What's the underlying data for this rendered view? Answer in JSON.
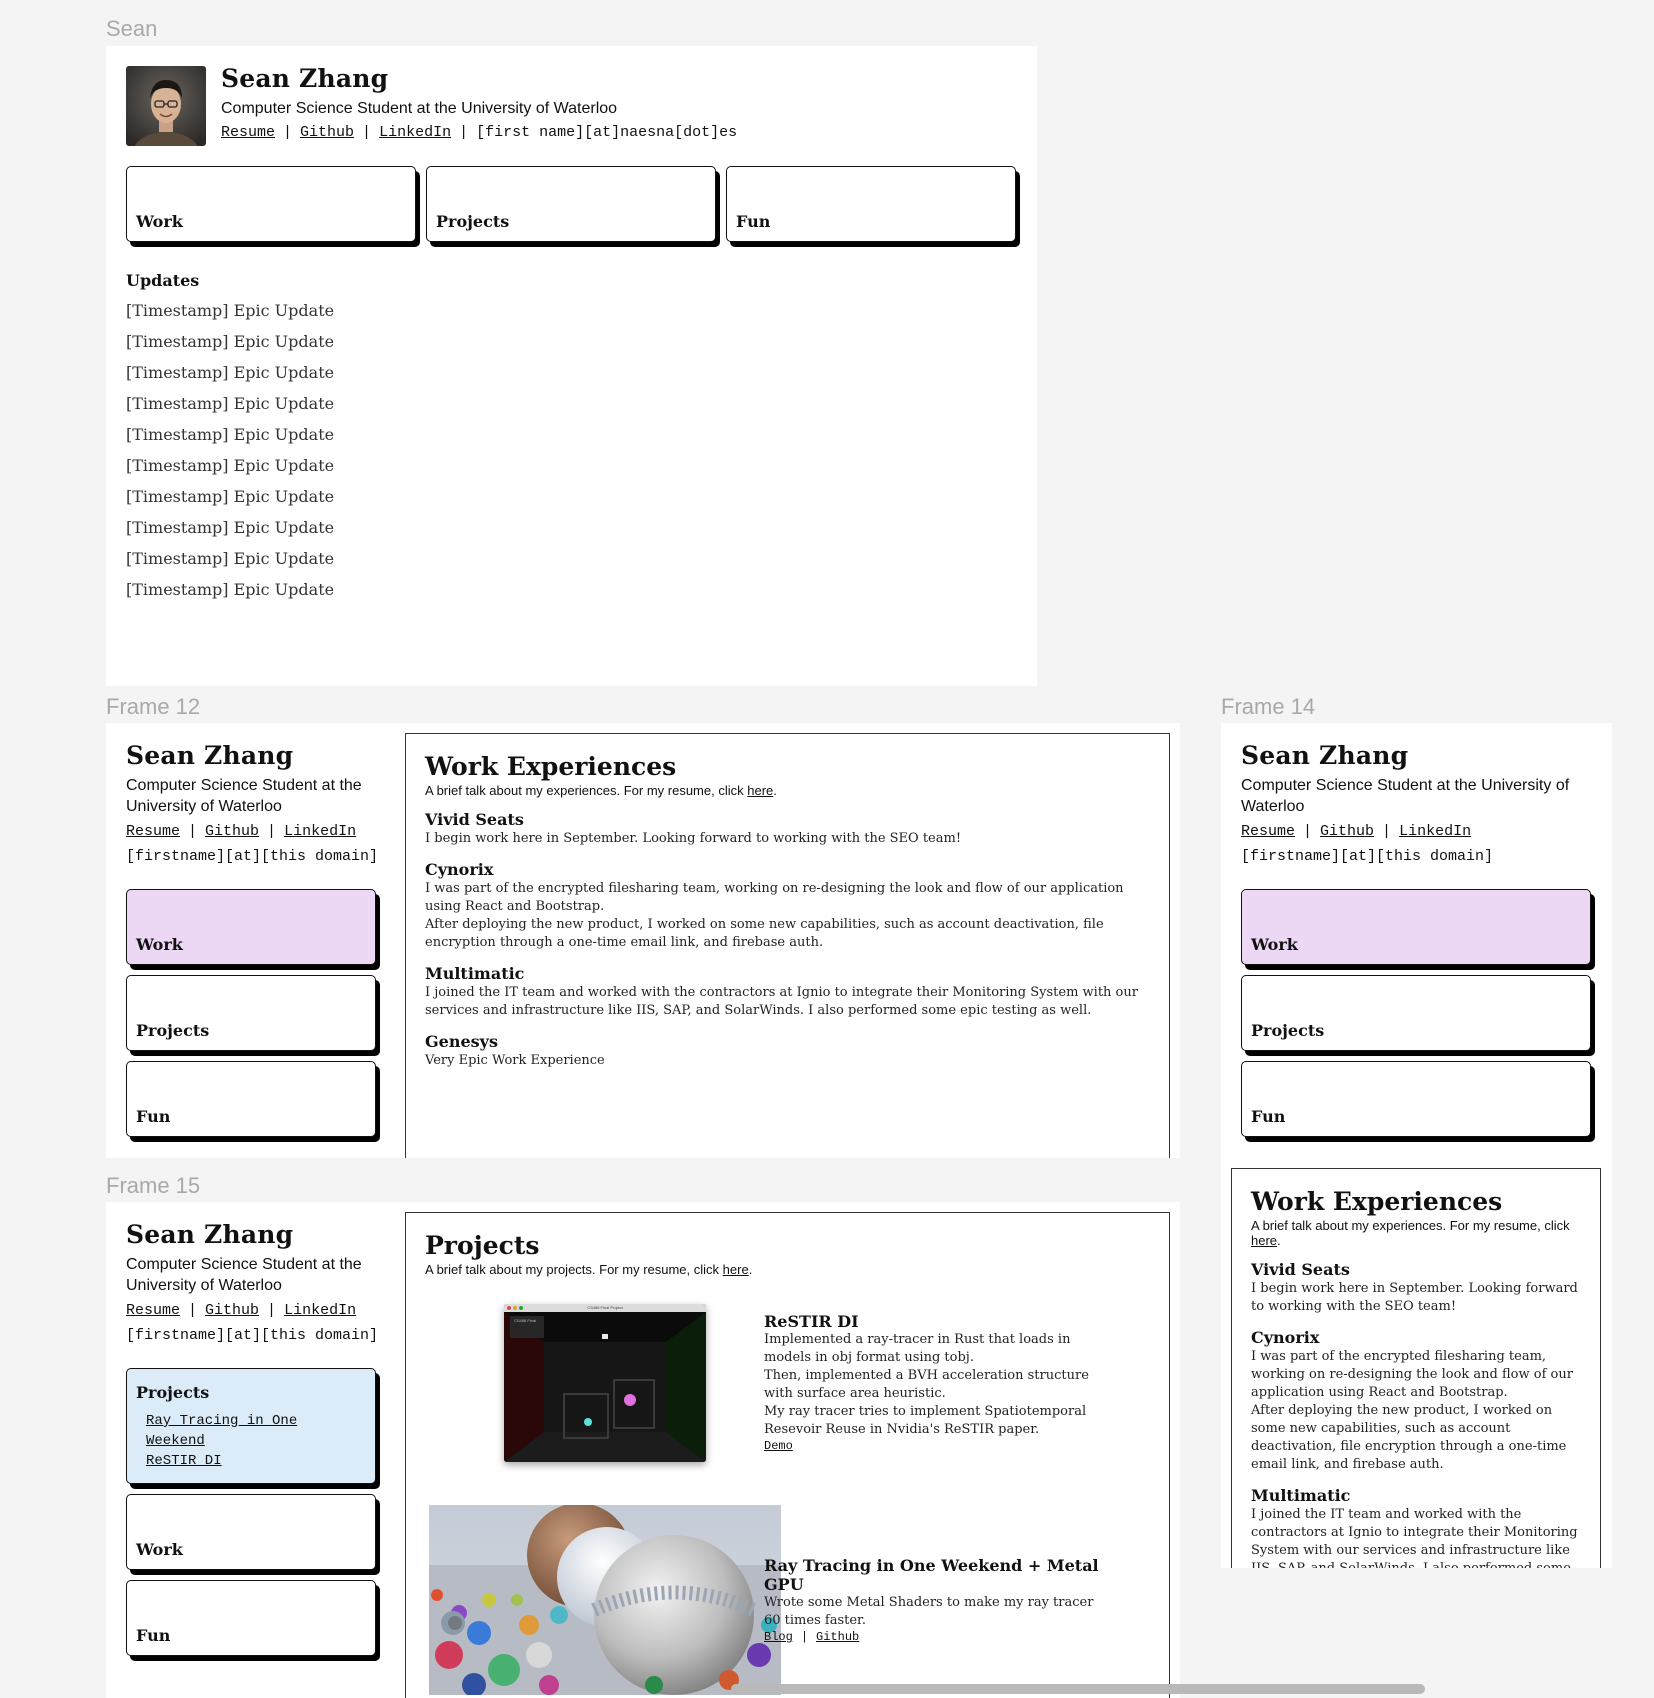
{
  "frames": {
    "sean": {
      "label": "Sean",
      "name": "Sean Zhang",
      "tagline": "Computer Science Student at the University of Waterloo",
      "links": [
        "Resume",
        "Github",
        "LinkedIn"
      ],
      "email": "[first name][at]naesna[dot]es",
      "nav": [
        "Work",
        "Projects",
        "Fun"
      ],
      "updates_title": "Updates",
      "updates": [
        "[Timestamp] Epic Update",
        "[Timestamp] Epic Update",
        "[Timestamp] Epic Update",
        "[Timestamp] Epic Update",
        "[Timestamp] Epic Update",
        "[Timestamp] Epic Update",
        "[Timestamp] Epic Update",
        "[Timestamp] Epic Update",
        "[Timestamp] Epic Update",
        "[Timestamp] Epic Update"
      ]
    },
    "frame12": {
      "label": "Frame 12",
      "name": "Sean Zhang",
      "tagline": "Computer Science Student at the University of Waterloo",
      "links": [
        "Resume",
        "Github",
        "LinkedIn"
      ],
      "email": "[firstname][at][this domain]",
      "nav": [
        "Work",
        "Projects",
        "Fun"
      ],
      "active": "Work"
    },
    "frame14": {
      "label": "Frame 14",
      "name": "Sean Zhang",
      "tagline": "Computer Science Student at the University of Waterloo",
      "links": [
        "Resume",
        "Github",
        "LinkedIn"
      ],
      "email": "[firstname][at][this domain]",
      "nav": [
        "Work",
        "Projects",
        "Fun"
      ],
      "active": "Work"
    },
    "frame15": {
      "label": "Frame 15",
      "name": "Sean Zhang",
      "tagline": "Computer Science Student at the University of Waterloo",
      "links": [
        "Resume",
        "Github",
        "LinkedIn"
      ],
      "email": "[firstname][at][this domain]",
      "nav_active_title": "Projects",
      "nav_sublinks": [
        "Ray Tracing in One Weekend",
        "ReSTIR DI"
      ],
      "nav_other": [
        "Work",
        "Fun"
      ]
    }
  },
  "work": {
    "title": "Work Experiences",
    "intro_prefix": "A brief talk about my experiences. For my resume, click ",
    "intro_link": "here",
    "intro_suffix": ".",
    "entries": [
      {
        "company": "Vivid Seats",
        "paragraphs": [
          "I begin work here in September. Looking forward to working with the SEO team!"
        ]
      },
      {
        "company": "Cynorix",
        "paragraphs": [
          "I was part of the encrypted filesharing team, working on re-designing the look and flow of our application using React and Bootstrap.",
          "After deploying the new product, I worked on some new capabilities, such as account deactivation, file encryption through a one-time email link, and firebase auth."
        ]
      },
      {
        "company": "Multimatic",
        "paragraphs": [
          "I joined the IT team and worked with the contractors at Ignio to integrate their Monitoring System with our services and infrastructure like IIS, SAP, and SolarWinds. I also performed some epic testing as well."
        ]
      },
      {
        "company": "Genesys",
        "paragraphs": [
          "Very Epic Work Experience"
        ]
      }
    ]
  },
  "projects": {
    "title": "Projects",
    "intro_prefix": "A brief talk about my projects. For my resume, click ",
    "intro_link": "here",
    "intro_suffix": ".",
    "restir": {
      "title": "ReSTIR DI",
      "lines": [
        "Implemented a ray-tracer in Rust that loads in models in obj format using tobj.",
        "Then, implemented a BVH acceleration structure with surface area heuristic.",
        "My ray tracer tries to implement Spatiotemporal Resevoir Reuse in Nvidia's ReSTIR paper."
      ],
      "links": [
        "Demo"
      ],
      "screenshot_title": "CS488 Final Project",
      "screenshot_tab": "CS488 Final"
    },
    "rtow": {
      "title": "Ray Tracing in One Weekend + Metal GPU",
      "lines": [
        "Wrote some Metal Shaders to make my ray tracer 60 times faster."
      ],
      "links": [
        "Blog",
        "Github"
      ]
    }
  }
}
